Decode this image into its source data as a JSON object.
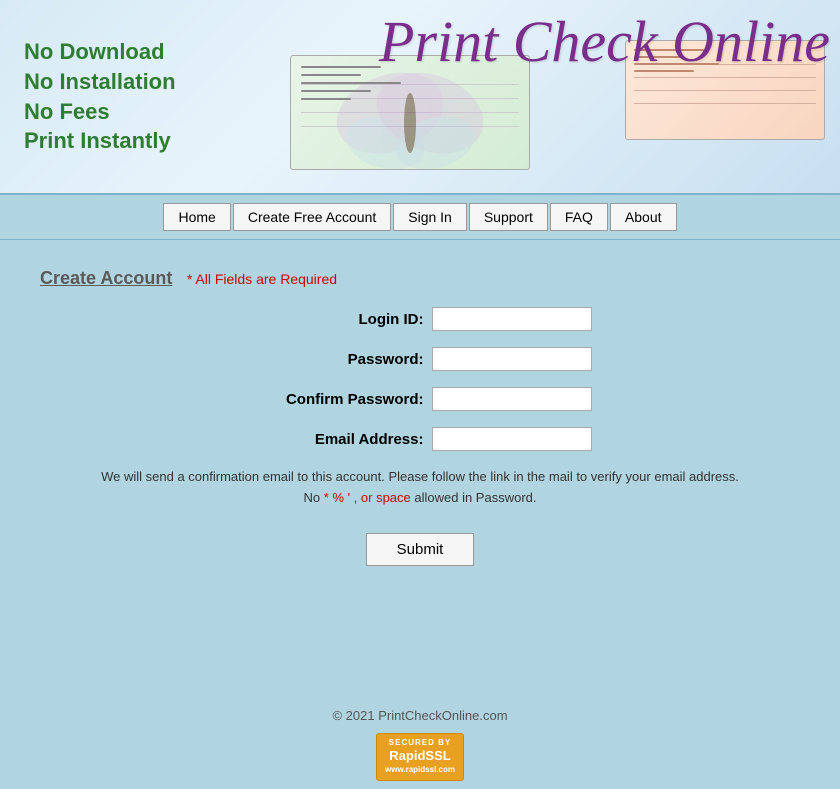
{
  "header": {
    "taglines": [
      "No Download",
      "No Installation",
      "No Fees",
      "Print Instantly"
    ],
    "logo_text": "Print Check Online"
  },
  "nav": {
    "items": [
      {
        "label": "Home",
        "id": "home"
      },
      {
        "label": "Create Free Account",
        "id": "create-free-account"
      },
      {
        "label": "Sign In",
        "id": "sign-in"
      },
      {
        "label": "Support",
        "id": "support"
      },
      {
        "label": "FAQ",
        "id": "faq"
      },
      {
        "label": "About",
        "id": "about"
      }
    ]
  },
  "form": {
    "title": "Create Account",
    "required_note": "* All Fields are Required",
    "fields": [
      {
        "label": "Login ID:",
        "id": "login-id",
        "type": "text"
      },
      {
        "label": "Password:",
        "id": "password",
        "type": "password"
      },
      {
        "label": "Confirm Password:",
        "id": "confirm-password",
        "type": "password"
      },
      {
        "label": "Email Address:",
        "id": "email-address",
        "type": "text"
      }
    ],
    "info_line1": "We will send a confirmation email to this account. Please follow the link in the mail to verify your email address.",
    "info_line2_prefix": "No ",
    "info_line2_special": "* % ' , or space",
    "info_line2_suffix": " allowed in Password.",
    "submit_label": "Submit"
  },
  "footer": {
    "copyright": "© 2021 PrintCheckOnline.com",
    "ssl_secured_by": "SECURED BY",
    "ssl_brand": "RapidSSL",
    "ssl_url": "www.rapidssl.com"
  }
}
